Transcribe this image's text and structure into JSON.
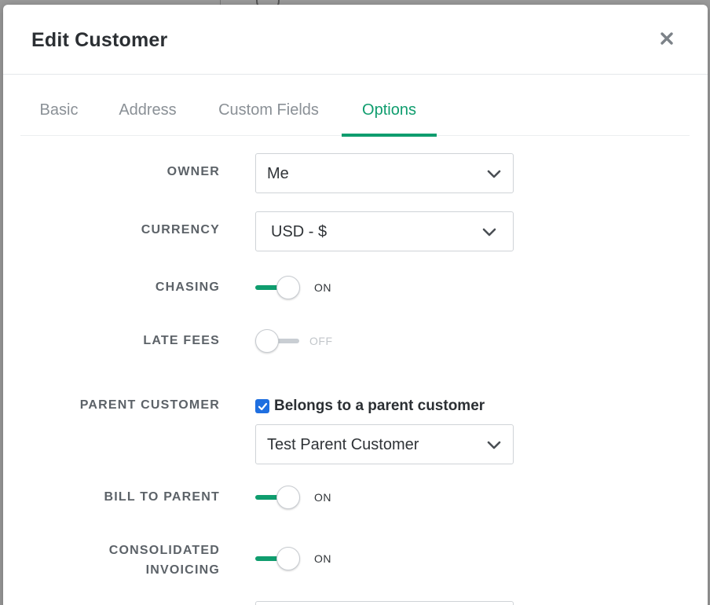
{
  "modal": {
    "title": "Edit Customer"
  },
  "tabs": [
    {
      "label": "Basic"
    },
    {
      "label": "Address"
    },
    {
      "label": "Custom Fields"
    },
    {
      "label": "Options",
      "active": true
    }
  ],
  "fields": {
    "owner": {
      "label": "OWNER",
      "value": "Me"
    },
    "currency": {
      "label": "CURRENCY",
      "value": "USD - $"
    },
    "chasing": {
      "label": "CHASING",
      "state": "ON"
    },
    "late_fees": {
      "label": "LATE FEES",
      "state": "OFF"
    },
    "parent_customer": {
      "label": "PARENT CUSTOMER",
      "checkbox_label": "Belongs to a parent customer",
      "checked": true,
      "value": "Test Parent Customer"
    },
    "bill_to_parent": {
      "label": "BILL TO PARENT",
      "state": "ON"
    },
    "consolidated_invoicing": {
      "label_line1": "CONSOLIDATED",
      "label_line2": "INVOICING",
      "state": "ON"
    }
  },
  "icons": {
    "close": "close-icon",
    "chevron": "chevron-down-icon",
    "check": "check-icon"
  },
  "colors": {
    "accent": "#0f9d6e",
    "checkbox": "#1f6fe0"
  }
}
